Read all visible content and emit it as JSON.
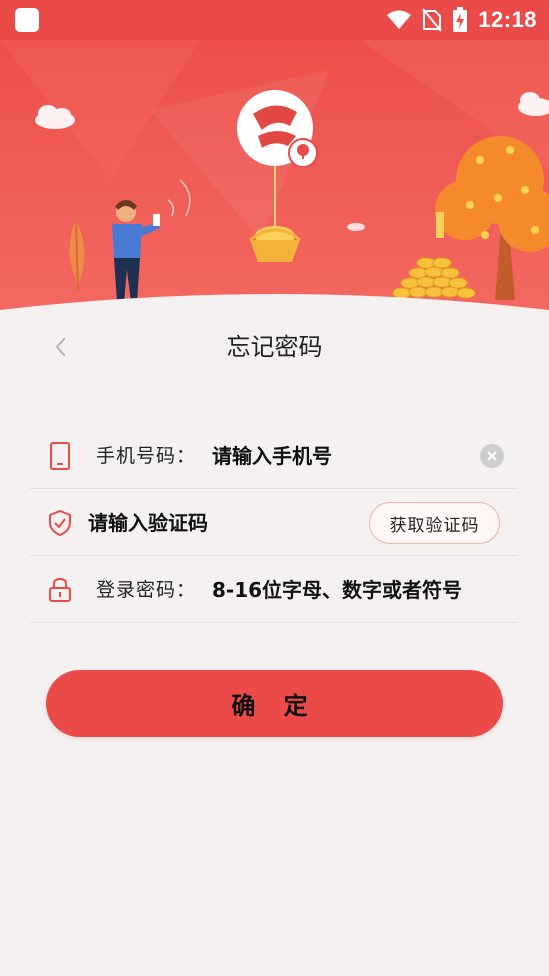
{
  "status_bar": {
    "time": "12:18",
    "icons": [
      "app-icon",
      "wifi-icon",
      "no-sim-icon",
      "battery-charging-icon"
    ]
  },
  "colors": {
    "primary": "#ea4b48",
    "background": "#f5f1f1",
    "divider": "#e4dede",
    "code_button_border": "#f0b1ab"
  },
  "header": {
    "title": "忘记密码",
    "back_icon": "chevron-left-icon"
  },
  "form": {
    "phone": {
      "icon": "phone-icon",
      "label": "手机号码：",
      "placeholder": "请输入手机号",
      "clear_icon": "clear-icon"
    },
    "verification": {
      "icon": "shield-icon",
      "placeholder": "请输入验证码",
      "button_label": "获取验证码"
    },
    "password": {
      "icon": "lock-icon",
      "label": "登录密码：",
      "placeholder": "8-16位字母、数字或者符号"
    }
  },
  "submit_label": "确 定"
}
